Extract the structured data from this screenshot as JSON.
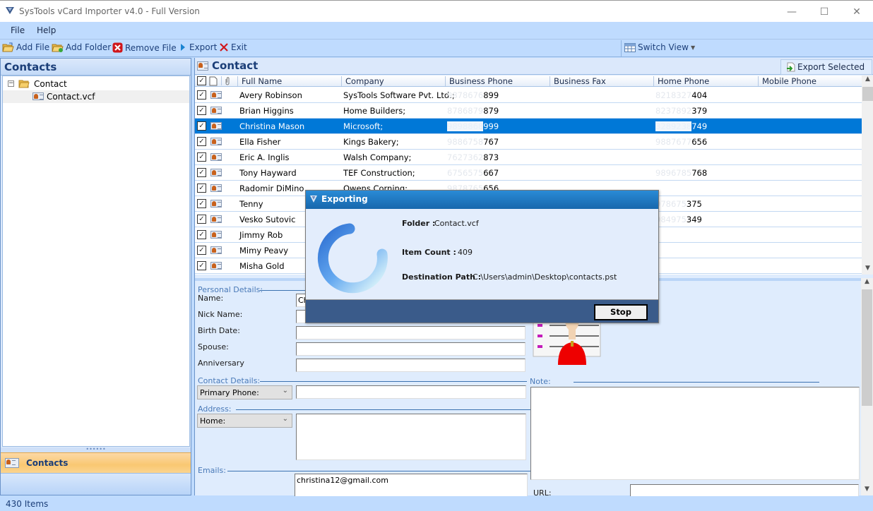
{
  "window": {
    "title": "SysTools vCard Importer v4.0 - Full Version",
    "controls": {
      "minimize": "—",
      "maximize": "☐",
      "close": "✕"
    }
  },
  "menu": [
    "File",
    "Help"
  ],
  "toolbar": {
    "add_file": "Add File",
    "add_folder": "Add Folder",
    "remove_file": "Remove File",
    "export": "Export",
    "exit": "Exit",
    "switch_view": "Switch View"
  },
  "left_panel": {
    "title": "Contacts",
    "tree": {
      "root": "Contact",
      "child": "Contact.vcf"
    },
    "splitter_dots": "••••••",
    "nav_item": "Contacts"
  },
  "right_panel": {
    "title": "Contact",
    "export_selected": "Export Selected"
  },
  "grid": {
    "columns": [
      "Full Name",
      "Company",
      "Business Phone",
      "Business Fax",
      "Home Phone",
      "Mobile Phone"
    ],
    "rows": [
      {
        "name": "Avery Robinson",
        "company": "SysTools Software Pvt. Ltd.;",
        "bp_mask": "9878676",
        "bp": "899",
        "hp_mask": "8218327",
        "hp": "404",
        "selected": false
      },
      {
        "name": "Brian Higgins",
        "company": "Home Builders;",
        "bp_mask": "8786879",
        "bp": "879",
        "hp_mask": "8237892",
        "hp": "379",
        "selected": false
      },
      {
        "name": "Christina Mason",
        "company": "Microsoft;",
        "bp_mask": "9898868",
        "bp": "999",
        "hp_mask": "3289238",
        "hp": "749",
        "selected": true
      },
      {
        "name": "Ella Fisher",
        "company": "Kings Bakery;",
        "bp_mask": "9886758",
        "bp": "767",
        "hp_mask": "9887677",
        "hp": "656",
        "selected": false
      },
      {
        "name": "Eric A. Inglis",
        "company": "Walsh Company;",
        "bp_mask": "7627362",
        "bp": "873",
        "hp_mask": "",
        "hp": "",
        "selected": false
      },
      {
        "name": "Tony Hayward",
        "company": "TEF Construction;",
        "bp_mask": "6756575",
        "bp": "667",
        "hp_mask": "9896785",
        "hp": "768",
        "selected": false
      },
      {
        "name": "Radomir DiMino",
        "company": "Owens Corning;",
        "bp_mask": "9878765",
        "bp": "656",
        "hp_mask": "",
        "hp": "",
        "selected": false
      },
      {
        "name": "Tenny",
        "company": "",
        "bp_mask": "",
        "bp": "",
        "hp_mask": "978675",
        "hp": "375",
        "selected": false
      },
      {
        "name": "Vesko Sutovic",
        "company": "",
        "bp_mask": "",
        "bp": "",
        "hp_mask": "984975",
        "hp": "349",
        "selected": false
      },
      {
        "name": "Jimmy Rob",
        "company": "",
        "bp_mask": "",
        "bp": "",
        "hp_mask": "",
        "hp": "",
        "selected": false
      },
      {
        "name": "Mimy Peavy",
        "company": "",
        "bp_mask": "",
        "bp": "",
        "hp_mask": "",
        "hp": "",
        "selected": false
      },
      {
        "name": "Misha Gold",
        "company": "",
        "bp_mask": "",
        "bp": "",
        "hp_mask": "",
        "hp": "",
        "selected": false
      }
    ]
  },
  "details": {
    "personal_section": "Personal Details:",
    "name_label": "Name:",
    "name_value": "Ch",
    "nick_label": "Nick Name:",
    "birth_label": "Birth Date:",
    "spouse_label": "Spouse:",
    "anniversary_label": "Anniversary",
    "contact_section": "Contact Details:",
    "phone_select": "Primary Phone:",
    "address_section": "Address:",
    "address_select": "Home:",
    "emails_section": "Emails:",
    "email_value": "christina12@gmail.com",
    "note_section": "Note:",
    "url_label": "URL:"
  },
  "dialog": {
    "title": "Exporting",
    "folder_label": "Folder :",
    "folder_value": "Contact.vcf",
    "count_label": "Item Count :",
    "count_value": "409",
    "dest_label": "Destination Path :",
    "dest_value": "C:\\Users\\admin\\Desktop\\contacts.pst",
    "stop": "Stop"
  },
  "status": {
    "items": "430 Items"
  }
}
